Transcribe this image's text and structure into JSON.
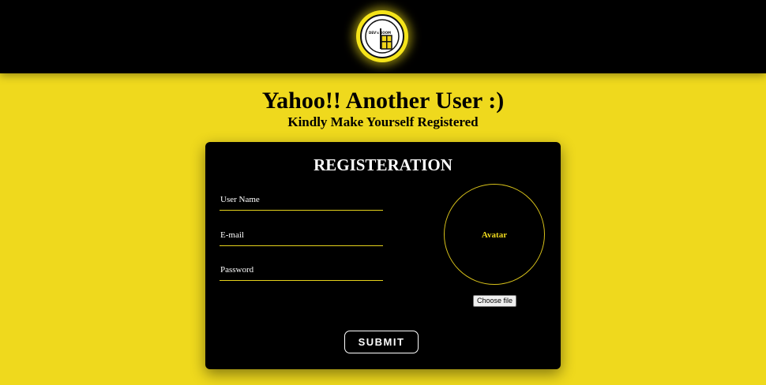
{
  "header": {
    "logo_text": "DEV's ROOM"
  },
  "main": {
    "title": "Yahoo!! Another User :)",
    "subtitle": "Kindly Make Yourself Registered"
  },
  "form": {
    "title": "REGISTERATION",
    "fields": [
      {
        "label": "User Name",
        "value": ""
      },
      {
        "label": "E-mail",
        "value": ""
      },
      {
        "label": "Password",
        "value": ""
      }
    ],
    "avatar_label": "Avatar",
    "file_button_label": "Choose file",
    "submit_label": "SUBMIT"
  },
  "colors": {
    "accent": "#efd91d",
    "header_bg": "#000000",
    "card_bg": "#000000"
  }
}
